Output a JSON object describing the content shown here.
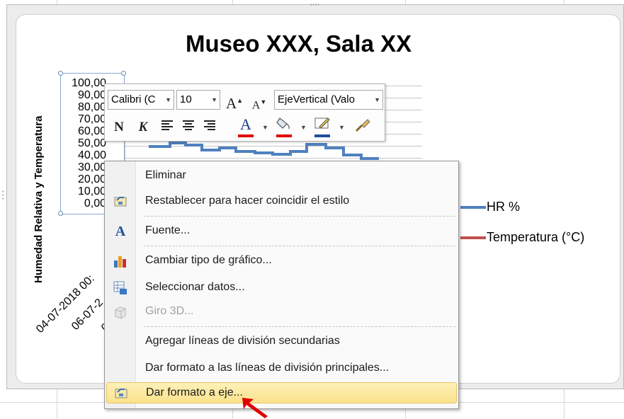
{
  "chart": {
    "title": "Museo XXX, Sala XX",
    "y_axis_title": "Humedad Relativa y Temperatura",
    "y_ticks": [
      "100,00",
      "90,00",
      "80,00",
      "70,00",
      "60,00",
      "50,00",
      "40,00",
      "30,00",
      "20,00",
      "10,00",
      "0,00"
    ],
    "x_ticks": [
      "04-07-2018 00:",
      "06-07-2",
      "0"
    ],
    "legend": [
      {
        "label": "HR %",
        "color": "#4f81bd"
      },
      {
        "label": "Temperatura (°C)",
        "color": "#c0504d"
      }
    ]
  },
  "mini_toolbar": {
    "font_name": "Calibri (C",
    "font_size": "10",
    "element_selector": "EjeVertical (Valo",
    "grow_font": "A",
    "shrink_font": "A",
    "bold": "N",
    "italic": "K",
    "font_color_label": "A",
    "font_color": "#e00000",
    "fill_color": "#e00000",
    "outline_color": "#1f4e9e"
  },
  "context_menu": {
    "items": [
      {
        "label": "Eliminar",
        "icon": "none",
        "enabled": true
      },
      {
        "label": "Restablecer para hacer coincidir el estilo",
        "icon": "reset-style-icon",
        "enabled": true
      },
      {
        "label": "Fuente...",
        "icon": "font-icon",
        "icon_text": "A",
        "enabled": true
      },
      {
        "label": "Cambiar tipo de gráfico...",
        "icon": "chart-type-icon",
        "enabled": true
      },
      {
        "label": "Seleccionar datos...",
        "icon": "select-data-icon",
        "enabled": true
      },
      {
        "label": "Giro 3D...",
        "icon": "rotation-3d-icon",
        "enabled": false
      },
      {
        "label": "Agregar líneas de división secundarias",
        "icon": "none",
        "enabled": true
      },
      {
        "label": "Dar formato a las líneas de división principales...",
        "icon": "none",
        "enabled": true
      },
      {
        "label": "Dar formato a eje...",
        "icon": "format-axis-icon",
        "enabled": true,
        "highlighted": true
      }
    ]
  },
  "annotation": {
    "arrow_color": "#e00000"
  }
}
